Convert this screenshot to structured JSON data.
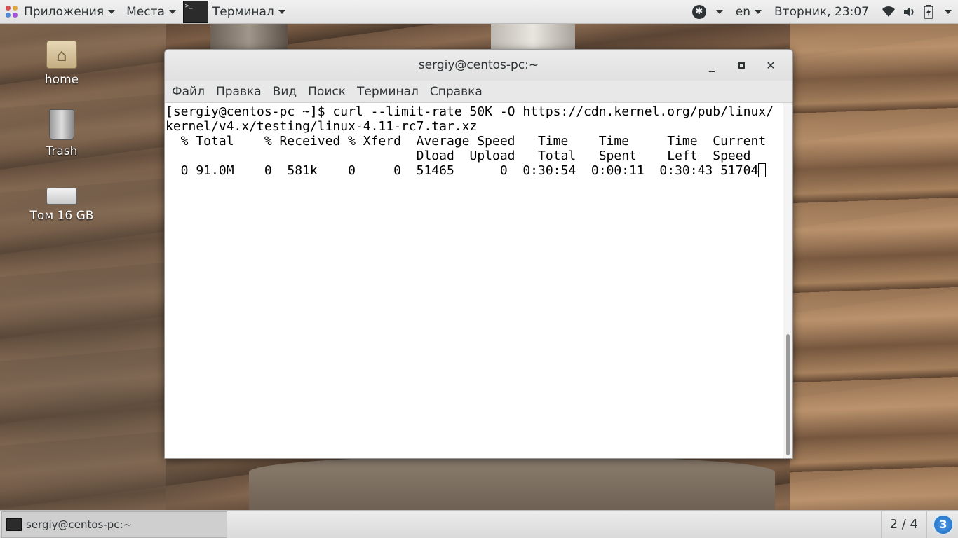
{
  "top_panel": {
    "applications_label": "Приложения",
    "places_label": "Места",
    "terminal_label": "Терминал",
    "language": "en",
    "datetime": "Вторник, 23:07"
  },
  "desktop_icons": [
    {
      "label": "home"
    },
    {
      "label": "Trash"
    },
    {
      "label": "Том 16 GB"
    }
  ],
  "window": {
    "title": "sergiy@centos-pc:~",
    "menu": [
      "Файл",
      "Правка",
      "Вид",
      "Поиск",
      "Терминал",
      "Справка"
    ],
    "terminal_lines": [
      "[sergiy@centos-pc ~]$ curl --limit-rate 50K -O https://cdn.kernel.org/pub/linux/",
      "kernel/v4.x/testing/linux-4.11-rc7.tar.xz",
      "  % Total    % Received % Xferd  Average Speed   Time    Time     Time  Current",
      "                                 Dload  Upload   Total   Spent    Left  Speed",
      "  0 91.0M    0  581k    0     0  51465      0  0:30:54  0:00:11  0:30:43 51704"
    ]
  },
  "taskbar": {
    "task_label": "sergiy@centos-pc:~",
    "workspace": "2 / 4",
    "notification_count": "3"
  }
}
